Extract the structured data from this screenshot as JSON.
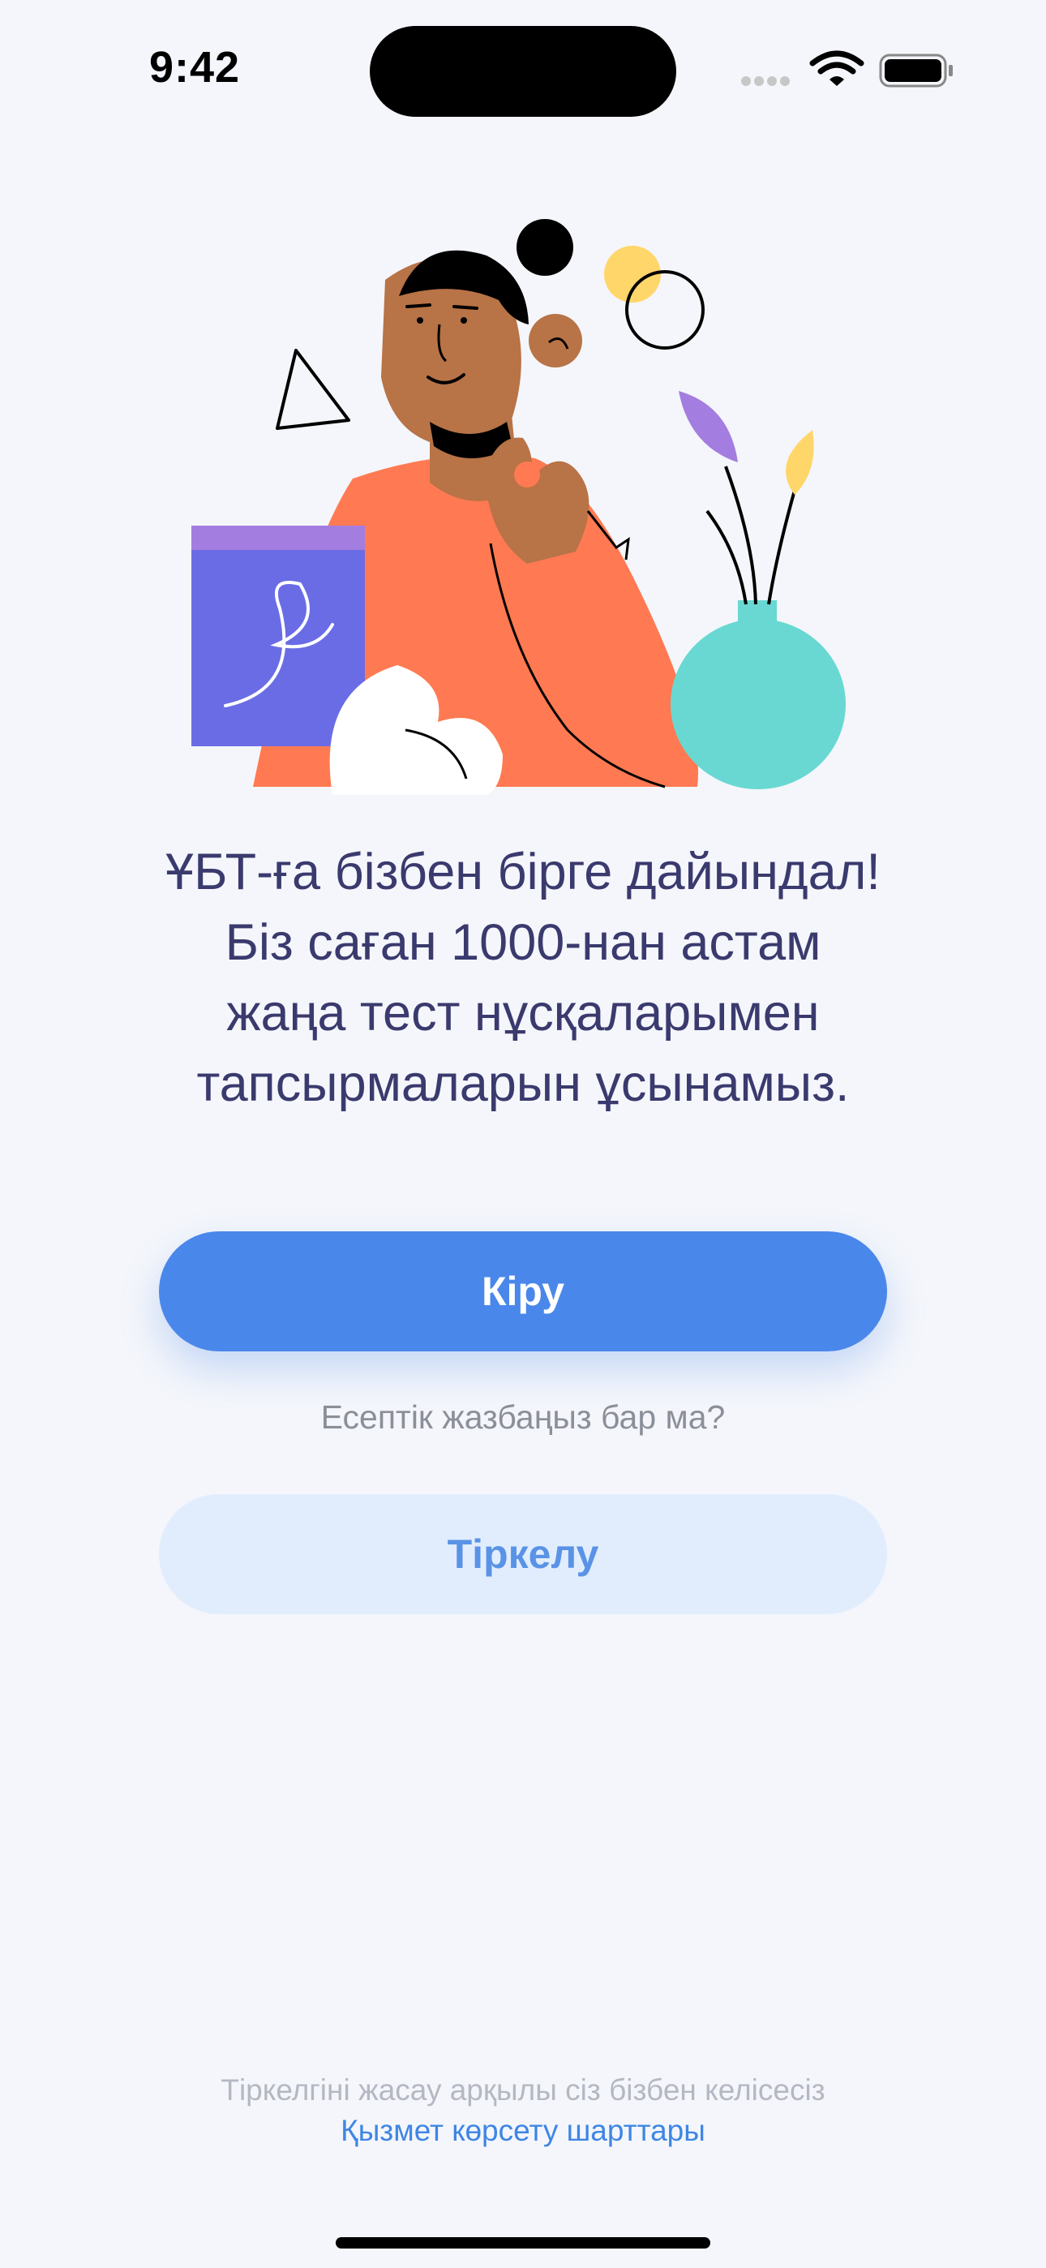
{
  "status_bar": {
    "time": "9:42",
    "icons": [
      "signal-dots-icon",
      "wifi-icon",
      "battery-icon"
    ]
  },
  "illustration": {
    "description_icon": "woman-with-book-illustration",
    "colors": {
      "skin": "#b87346",
      "sweater": "#ff7a52",
      "book": "#6a6ce6",
      "vase": "#69d8d2",
      "yellow": "#ffd66a",
      "purple_leaf": "#a47de0"
    }
  },
  "headline": {
    "lines": [
      "ҰБТ-ға бізбен бірге дайындал!",
      "Біз саған 1000-нан астам",
      "жаңа тест нұсқаларымен",
      "тапсырмаларын ұсынамыз."
    ]
  },
  "actions": {
    "login_label": "Кіру",
    "account_question": "Есептік жазбаңыз бар ма?",
    "register_label": "Тіркелу"
  },
  "footer": {
    "terms_text": "Тіркелгіні жасау арқылы сіз бізбен келісесіз",
    "terms_link": "Қызмет көрсету шарттары"
  },
  "colors": {
    "accent": "#4a87ea",
    "accent_light": "#e1edfd",
    "headline": "#3a3a6e",
    "background": "#f4f6fb"
  }
}
